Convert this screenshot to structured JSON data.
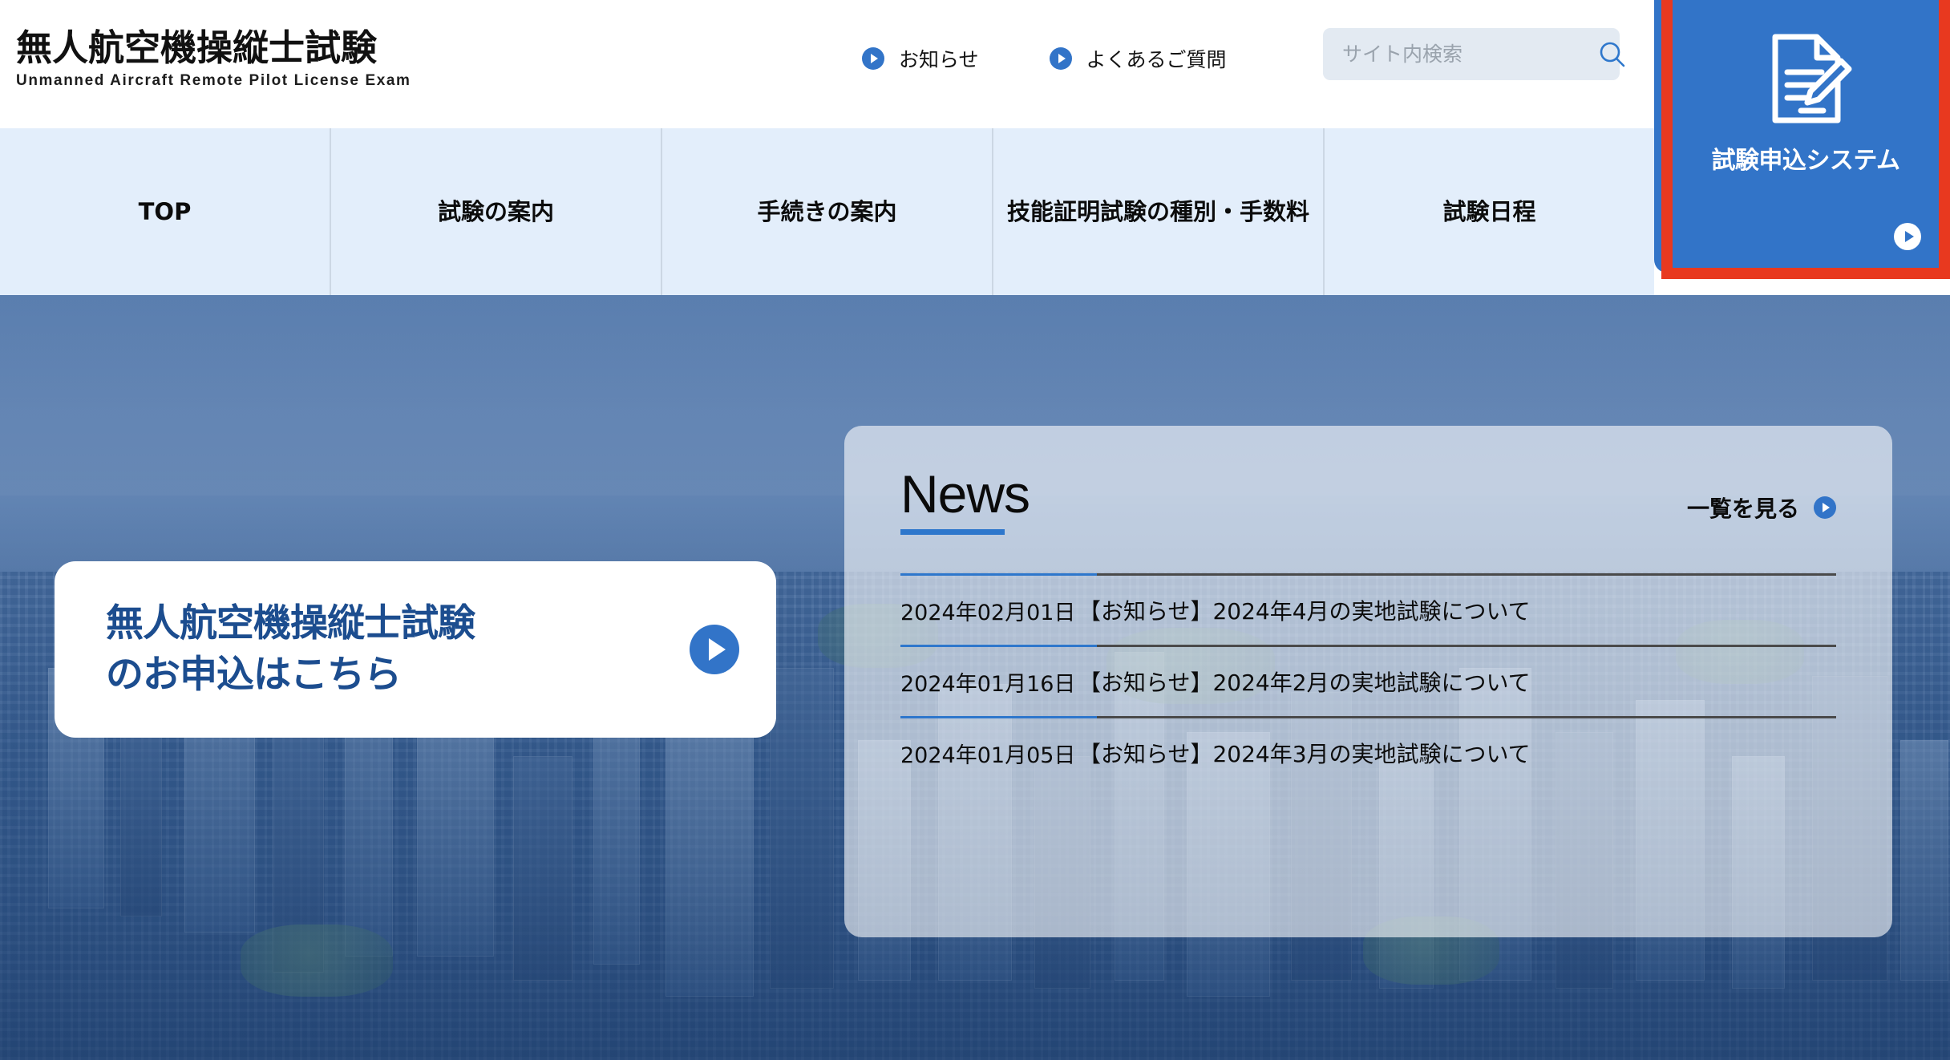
{
  "header": {
    "logo_jp": "無人航空機操縦士試験",
    "logo_en": "Unmanned Aircraft Remote Pilot License Exam",
    "links": [
      {
        "label": "お知らせ",
        "icon": "play-circle-icon"
      },
      {
        "label": "よくあるご質問",
        "icon": "play-circle-icon"
      }
    ],
    "search": {
      "placeholder": "サイト内検索",
      "value": "",
      "icon": "search-icon"
    },
    "apply_system": {
      "label": "試験申込システム",
      "icon": "document-pencil-icon",
      "arrow_icon": "play-circle-icon",
      "bg_color": "#3274c8",
      "highlight_color": "#e8391f"
    }
  },
  "nav": {
    "items": [
      {
        "label": "TOP"
      },
      {
        "label": "試験の案内"
      },
      {
        "label": "手続きの案内"
      },
      {
        "label": "技能証明試験の種別・手数料"
      },
      {
        "label": "試験日程"
      }
    ],
    "bg_color": "#e3eefb"
  },
  "hero": {
    "cta": {
      "line1": "無人航空機操縦士試験",
      "line2": "のお申込はこちら",
      "arrow_icon": "play-circle-icon",
      "text_color": "#1c4d8f"
    }
  },
  "news": {
    "title": "News",
    "more_label": "一覧を見る",
    "more_icon": "play-circle-icon",
    "accent_color": "#2e77cc",
    "items": [
      {
        "date": "2024年02月01日",
        "text": "【お知らせ】2024年4月の実地試験について"
      },
      {
        "date": "2024年01月16日",
        "text": "【お知らせ】2024年2月の実地試験について"
      },
      {
        "date": "2024年01月05日",
        "text": "【お知らせ】2024年3月の実地試験について"
      }
    ]
  }
}
